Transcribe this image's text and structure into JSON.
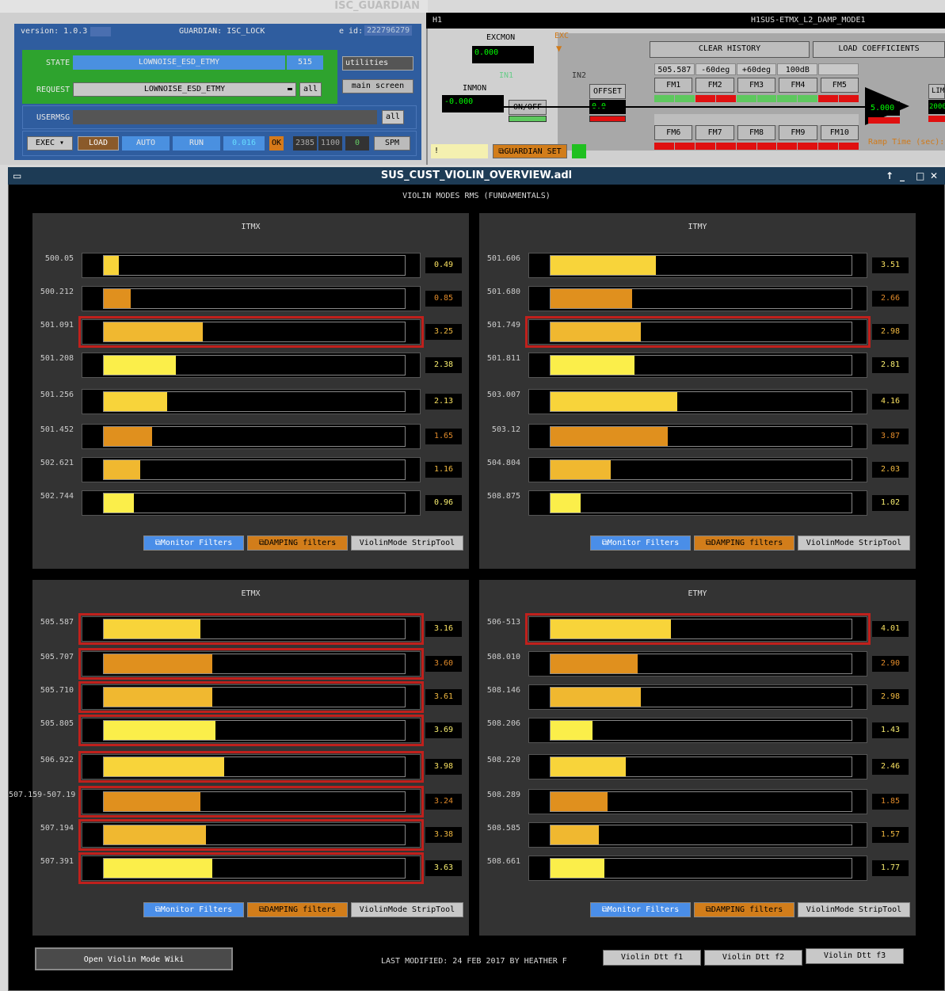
{
  "guardian": {
    "window_title": "ISC_GUARDIAN",
    "version": "version: 1.0.3",
    "guardian": "GUARDIAN: ISC_LOCK",
    "eid_label": "e id:",
    "eid": "222796279",
    "state_label": "STATE",
    "state": "LOWNOISE_ESD_ETMY",
    "state_num": "515",
    "request_label": "REQUEST",
    "request": "LOWNOISE_ESD_ETMY",
    "all": "all",
    "utilities": "utilities",
    "main_screen": "main screen",
    "usermsg_label": "USERMSG",
    "exec": "EXEC",
    "load": "LOAD",
    "auto": "AUTO",
    "run": "RUN",
    "runtime": "0.016",
    "ok": "OK",
    "n1": "2385",
    "n2": "1100",
    "n3": "0",
    "spm": "SPM"
  },
  "filter": {
    "site": "H1",
    "title": "H1SUS-ETMX_L2_DAMP_MODE1",
    "excmon_label": "EXCMON",
    "excmon": "0.000",
    "exc": "EXC",
    "in1": "IN1",
    "in2": "IN2",
    "inmon_label": "INMON",
    "inmon": "-0.000",
    "onoff": "ON/OFF",
    "offset": "OFFSET",
    "offset_val": "0.0",
    "clear_history": "CLEAR HISTORY",
    "load_coefficients": "LOAD COEFFICIENTS",
    "fm_labels_top": [
      "505.587",
      "-60deg",
      "+60deg",
      "100dB",
      ""
    ],
    "fm_top": [
      "FM1",
      "FM2",
      "FM3",
      "FM4",
      "FM5"
    ],
    "fm_bottom": [
      "FM6",
      "FM7",
      "FM8",
      "FM9",
      "FM10"
    ],
    "gain": "5.000",
    "limit": "LIM",
    "limit_val": "2000",
    "ramp_time": "Ramp Time (sec):",
    "bang": "!",
    "guardian_set": "GUARDIAN SET"
  },
  "main": {
    "window_title": "SUS_CUST_VIOLIN_OVERVIEW.adl",
    "header": "VIOLIN MODES RMS (FUNDAMENTALS)",
    "panels": [
      {
        "title": "ITMX",
        "modes": [
          {
            "label": "500.05",
            "value": "0.49",
            "level": 0.05,
            "color": "#f8d43a",
            "vcolor": "#f8e060",
            "hl": false
          },
          {
            "label": "500.212",
            "value": "0.85",
            "level": 0.09,
            "color": "#e0901e",
            "vcolor": "#e08a2a",
            "hl": false
          },
          {
            "label": "501.091",
            "value": "3.25",
            "level": 0.33,
            "color": "#f0b830",
            "vcolor": "#f0b840",
            "hl": true
          },
          {
            "label": "501.208",
            "value": "2.38",
            "level": 0.24,
            "color": "#fbee4a",
            "vcolor": "#f8ee70",
            "hl": false
          },
          {
            "label": "501.256",
            "value": "2.13",
            "level": 0.21,
            "color": "#f8d43a",
            "vcolor": "#f8e060",
            "hl": false
          },
          {
            "label": "501.452",
            "value": "1.65",
            "level": 0.16,
            "color": "#e0901e",
            "vcolor": "#e08a2a",
            "hl": false
          },
          {
            "label": "502.621",
            "value": "1.16",
            "level": 0.12,
            "color": "#f0b830",
            "vcolor": "#f0b840",
            "hl": false
          },
          {
            "label": "502.744",
            "value": "0.96",
            "level": 0.1,
            "color": "#fbee4a",
            "vcolor": "#f8ee70",
            "hl": false
          }
        ],
        "buttons": [
          "Monitor Filters",
          "DAMPING filters",
          "ViolinMode StripTool"
        ]
      },
      {
        "title": "ITMY",
        "modes": [
          {
            "label": "501.606",
            "value": "3.51",
            "level": 0.35,
            "color": "#f8d43a",
            "vcolor": "#f8e060",
            "hl": false
          },
          {
            "label": "501.680",
            "value": "2.66",
            "level": 0.27,
            "color": "#e0901e",
            "vcolor": "#e08a2a",
            "hl": false
          },
          {
            "label": "501.749",
            "value": "2.98",
            "level": 0.3,
            "color": "#f0b830",
            "vcolor": "#f0b840",
            "hl": true
          },
          {
            "label": "501.811",
            "value": "2.81",
            "level": 0.28,
            "color": "#fbee4a",
            "vcolor": "#f8ee70",
            "hl": false
          },
          {
            "label": "503.007",
            "value": "4.16",
            "level": 0.42,
            "color": "#f8d43a",
            "vcolor": "#f8e060",
            "hl": false
          },
          {
            "label": "503.12",
            "value": "3.87",
            "level": 0.39,
            "color": "#e0901e",
            "vcolor": "#e08a2a",
            "hl": false
          },
          {
            "label": "504.804",
            "value": "2.03",
            "level": 0.2,
            "color": "#f0b830",
            "vcolor": "#f0b840",
            "hl": false
          },
          {
            "label": "508.875",
            "value": "1.02",
            "level": 0.1,
            "color": "#fbee4a",
            "vcolor": "#f8ee70",
            "hl": false
          }
        ],
        "buttons": [
          "Monitor Filters",
          "DAMPING filters",
          "ViolinMode StripTool"
        ]
      },
      {
        "title": "ETMX",
        "modes": [
          {
            "label": "505.587",
            "value": "3.16",
            "level": 0.32,
            "color": "#f8d43a",
            "vcolor": "#f8e060",
            "hl": true
          },
          {
            "label": "505.707",
            "value": "3.60",
            "level": 0.36,
            "color": "#e0901e",
            "vcolor": "#e08a2a",
            "hl": true
          },
          {
            "label": "505.710",
            "value": "3.61",
            "level": 0.36,
            "color": "#f0b830",
            "vcolor": "#f0b840",
            "hl": true
          },
          {
            "label": "505.805",
            "value": "3.69",
            "level": 0.37,
            "color": "#fbee4a",
            "vcolor": "#f8ee70",
            "hl": true
          },
          {
            "label": "506.922",
            "value": "3.98",
            "level": 0.4,
            "color": "#f8d43a",
            "vcolor": "#f8e060",
            "hl": true
          },
          {
            "label": "507.159-507.19",
            "value": "3.24",
            "level": 0.32,
            "color": "#e0901e",
            "vcolor": "#e08a2a",
            "hl": true
          },
          {
            "label": "507.194",
            "value": "3.38",
            "level": 0.34,
            "color": "#f0b830",
            "vcolor": "#f0b840",
            "hl": true
          },
          {
            "label": "507.391",
            "value": "3.63",
            "level": 0.36,
            "color": "#fbee4a",
            "vcolor": "#f8ee70",
            "hl": true
          }
        ],
        "buttons": [
          "Monitor Filters",
          "DAMPING filters",
          "ViolinMode StripTool"
        ]
      },
      {
        "title": "ETMY",
        "modes": [
          {
            "label": "506-513",
            "value": "4.01",
            "level": 0.4,
            "color": "#f8d43a",
            "vcolor": "#f8e060",
            "hl": true
          },
          {
            "label": "508.010",
            "value": "2.90",
            "level": 0.29,
            "color": "#e0901e",
            "vcolor": "#e08a2a",
            "hl": false
          },
          {
            "label": "508.146",
            "value": "2.98",
            "level": 0.3,
            "color": "#f0b830",
            "vcolor": "#f0b840",
            "hl": false
          },
          {
            "label": "508.206",
            "value": "1.43",
            "level": 0.14,
            "color": "#fbee4a",
            "vcolor": "#f8ee70",
            "hl": false
          },
          {
            "label": "508.220",
            "value": "2.46",
            "level": 0.25,
            "color": "#f8d43a",
            "vcolor": "#f8e060",
            "hl": false
          },
          {
            "label": "508.289",
            "value": "1.85",
            "level": 0.19,
            "color": "#e0901e",
            "vcolor": "#e08a2a",
            "hl": false
          },
          {
            "label": "508.585",
            "value": "1.57",
            "level": 0.16,
            "color": "#f0b830",
            "vcolor": "#f0b840",
            "hl": false
          },
          {
            "label": "508.661",
            "value": "1.77",
            "level": 0.18,
            "color": "#fbee4a",
            "vcolor": "#f8ee70",
            "hl": false
          }
        ],
        "buttons": [
          "Monitor Filters",
          "DAMPING filters",
          "ViolinMode StripTool"
        ]
      }
    ],
    "wiki_button": "Open Violin Mode Wiki",
    "last_modified": "LAST MODIFIED: 24 FEB 2017 BY HEATHER F",
    "dtt_buttons": [
      "Violin Dtt f1",
      "Violin Dtt f2",
      "Violin Dtt f3"
    ]
  }
}
